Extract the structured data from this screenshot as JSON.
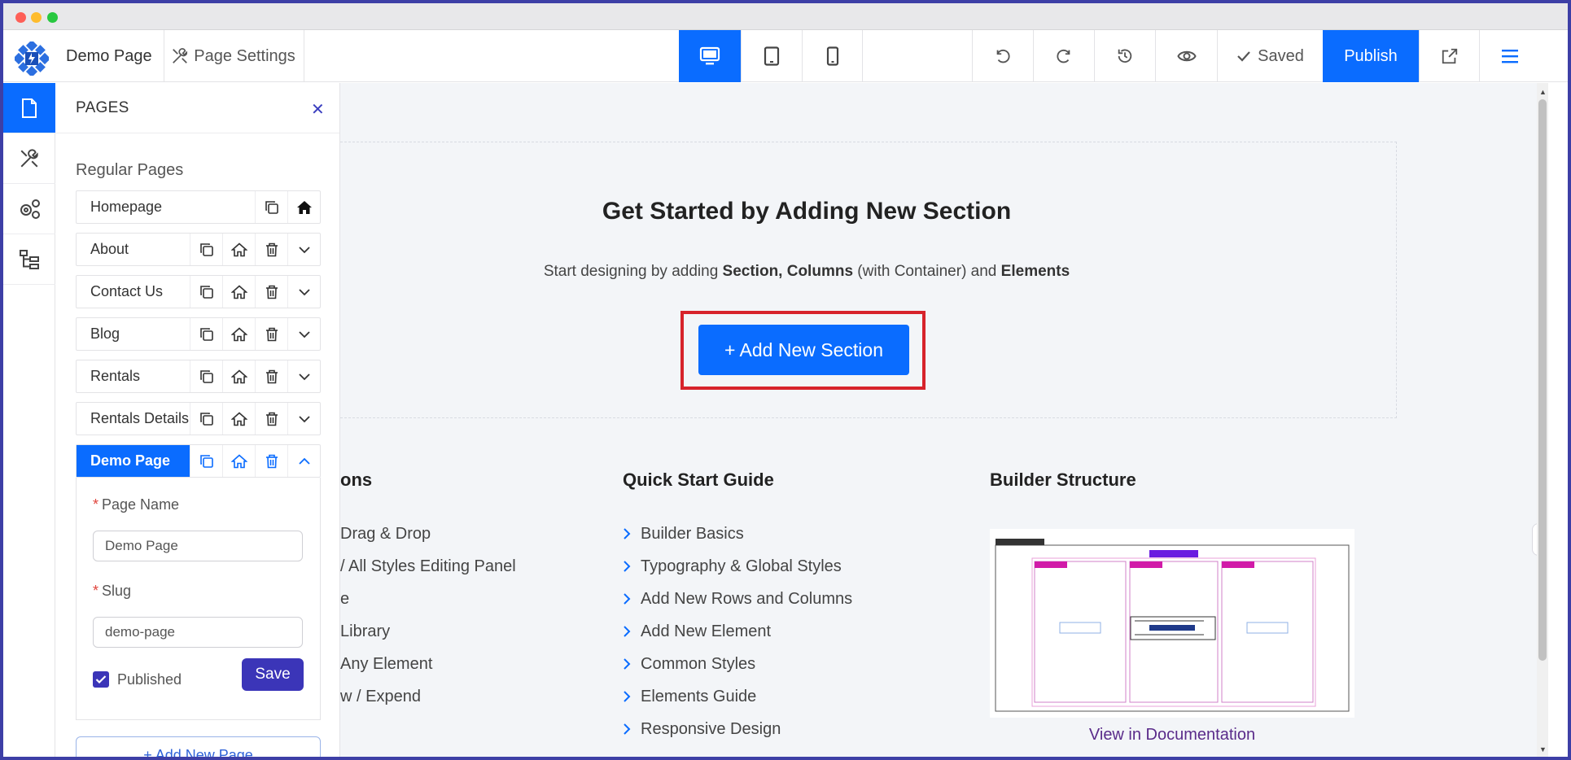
{
  "app": {
    "doc_title": "Demo Page",
    "page_settings_label": "Page Settings",
    "saved_label": "Saved",
    "publish_label": "Publish"
  },
  "panel": {
    "title": "PAGES",
    "section_label": "Regular Pages",
    "pages": [
      {
        "label": "Homepage"
      },
      {
        "label": "About"
      },
      {
        "label": "Contact Us"
      },
      {
        "label": "Blog"
      },
      {
        "label": "Rentals"
      },
      {
        "label": "Rentals Details"
      },
      {
        "label": "Demo Page"
      }
    ],
    "edit": {
      "page_name_label": "Page Name",
      "page_name_value": "Demo Page",
      "slug_label": "Slug",
      "slug_value": "demo-page",
      "published_label": "Published",
      "published_checked": true,
      "save_label": "Save"
    },
    "add_page_label": "+ Add New Page"
  },
  "canvas": {
    "hero_title": "Get Started by Adding New Section",
    "hero_sub_pre": "Start designing by adding ",
    "hero_sub_b1": "Section, Columns",
    "hero_sub_mid": " (with Container) and ",
    "hero_sub_b2": "Elements",
    "add_section_label": "+ Add New Section",
    "col1_title": "ons",
    "col1_items": [
      "Drag & Drop",
      "/ All Styles Editing Panel",
      "e",
      "Library",
      "Any Element",
      "w / Expend"
    ],
    "col2_title": "Quick Start Guide",
    "col2_items": [
      "Builder Basics",
      "Typography & Global Styles",
      "Add New Rows and Columns",
      "Add New Element",
      "Common Styles",
      "Elements Guide",
      "Responsive Design"
    ],
    "col3_title": "Builder Structure",
    "view_doc_label": "View in Documentation"
  },
  "colors": {
    "accent": "#0a6cff",
    "save": "#3b35b8",
    "highlight": "#d7232b"
  }
}
